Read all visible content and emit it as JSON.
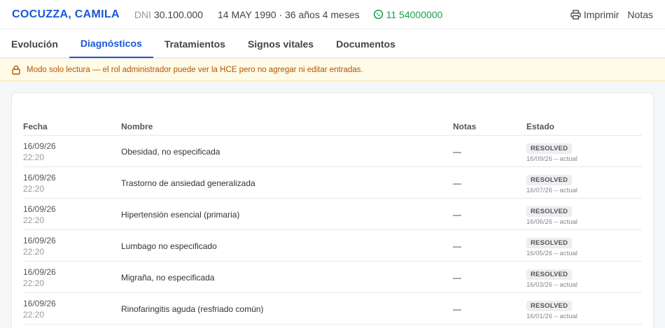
{
  "patient": {
    "name": "COCUZZA, CAMILA",
    "dni_label": "DNI",
    "dni": "30.100.000",
    "birth": "14 MAY 1990 · 36 años 4 meses",
    "phone": "11 54000000"
  },
  "header_actions": {
    "print": "Imprimir",
    "notes": "Notas"
  },
  "tabs": [
    {
      "label": "Evolución"
    },
    {
      "label": "Diagnósticos"
    },
    {
      "label": "Tratamientos"
    },
    {
      "label": "Signos vitales"
    },
    {
      "label": "Documentos"
    }
  ],
  "active_tab": "Diagnósticos",
  "banner": {
    "text": "Modo solo lectura — el rol administrador puede ver la HCE pero no agregar ni editar entradas."
  },
  "table": {
    "columns": [
      "Fecha",
      "Nombre",
      "Notas",
      "Estado"
    ],
    "rows": [
      {
        "date": "16/09/26",
        "time": "22:20",
        "name": "Obesidad, no especificada",
        "notes": "—",
        "status": "RESOLVED",
        "range": "16/09/26 – actual"
      },
      {
        "date": "16/09/26",
        "time": "22:20",
        "name": "Trastorno de ansiedad generalizada",
        "notes": "—",
        "status": "RESOLVED",
        "range": "16/07/26 – actual"
      },
      {
        "date": "16/09/26",
        "time": "22:20",
        "name": "Hipertensión esencial (primaria)",
        "notes": "—",
        "status": "RESOLVED",
        "range": "16/06/26 – actual"
      },
      {
        "date": "16/09/26",
        "time": "22:20",
        "name": "Lumbago no especificado",
        "notes": "—",
        "status": "RESOLVED",
        "range": "16/05/26 – actual"
      },
      {
        "date": "16/09/26",
        "time": "22:20",
        "name": "Migraña, no especificada",
        "notes": "—",
        "status": "RESOLVED",
        "range": "16/03/26 – actual"
      },
      {
        "date": "16/09/26",
        "time": "22:20",
        "name": "Rinofaringitis aguda (resfriado común)",
        "notes": "—",
        "status": "RESOLVED",
        "range": "16/01/26 – actual"
      }
    ]
  },
  "colors": {
    "accent": "#1a56db",
    "whatsapp": "#16a34a",
    "warning": "#b45309",
    "warning_bg": "#fffbe6"
  }
}
